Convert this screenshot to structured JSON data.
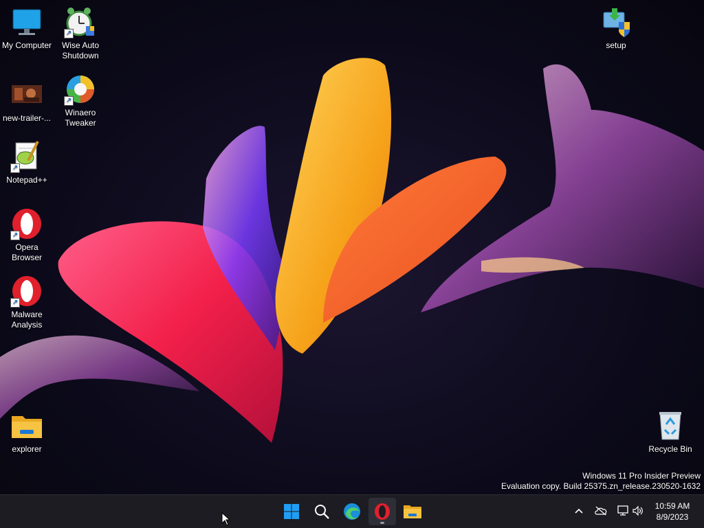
{
  "desktop": {
    "icons": [
      {
        "label": "My Computer",
        "icon": "computer-icon"
      },
      {
        "label": "Wise Auto Shutdown",
        "icon": "alarm-clock-icon"
      },
      {
        "label": "setup",
        "icon": "setup-installer-icon"
      },
      {
        "label": "new-trailer-...",
        "icon": "video-thumbnail-icon"
      },
      {
        "label": "Winaero Tweaker",
        "icon": "winaero-tweaker-icon"
      },
      {
        "label": "Notepad++",
        "icon": "notepad-plus-plus-icon"
      },
      {
        "label": "Opera Browser",
        "icon": "opera-icon"
      },
      {
        "label": "Malware Analysis",
        "icon": "opera-icon"
      },
      {
        "label": "explorer",
        "icon": "folder-icon"
      },
      {
        "label": "Recycle Bin",
        "icon": "recycle-bin-icon"
      }
    ]
  },
  "watermark": {
    "line1": "Windows 11 Pro Insider Preview",
    "line2": "Evaluation copy. Build 25375.zn_release.230520-1632"
  },
  "taskbar": {
    "apps": [
      "start-icon",
      "search-icon",
      "edge-icon",
      "opera-icon",
      "file-explorer-icon"
    ],
    "active_app": "opera-icon",
    "tray": [
      "chevron-up-icon",
      "onedrive-icon",
      "network-icon",
      "volume-icon"
    ],
    "time": "10:59 AM",
    "date": "8/9/2023"
  },
  "colors": {
    "taskbar_bg": "#1c1c22",
    "opera_red": "#e0202c",
    "windows_blue": "#1e9ef5",
    "folder_yellow": "#f6c342"
  }
}
